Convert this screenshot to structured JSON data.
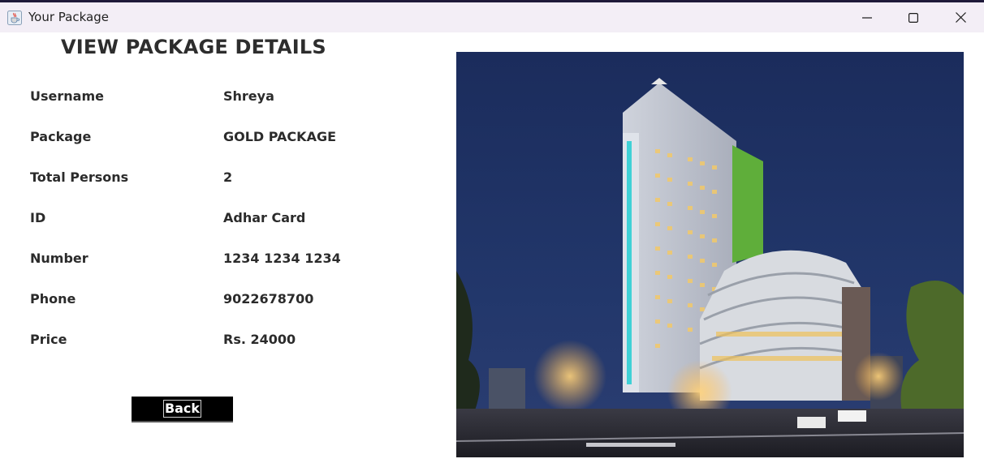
{
  "window": {
    "title": "Your Package",
    "icon": "java-cup-icon",
    "controls": [
      "minimize-icon",
      "maximize-icon",
      "close-icon"
    ]
  },
  "page": {
    "heading": "VIEW PACKAGE DETAILS",
    "fields": [
      {
        "label": "Username",
        "value": "Shreya"
      },
      {
        "label": "Package",
        "value": "GOLD PACKAGE"
      },
      {
        "label": "Total Persons",
        "value": "2"
      },
      {
        "label": "ID",
        "value": "Adhar Card"
      },
      {
        "label": "Number",
        "value": "1234 1234 1234"
      },
      {
        "label": "Phone",
        "value": "9022678700"
      },
      {
        "label": "Price",
        "value": "Rs. 24000"
      }
    ],
    "back_label": "Back"
  },
  "colors": {
    "titlebar_bg": "#f3eef6",
    "button_bg": "#000000",
    "text": "#2b2b2b"
  }
}
